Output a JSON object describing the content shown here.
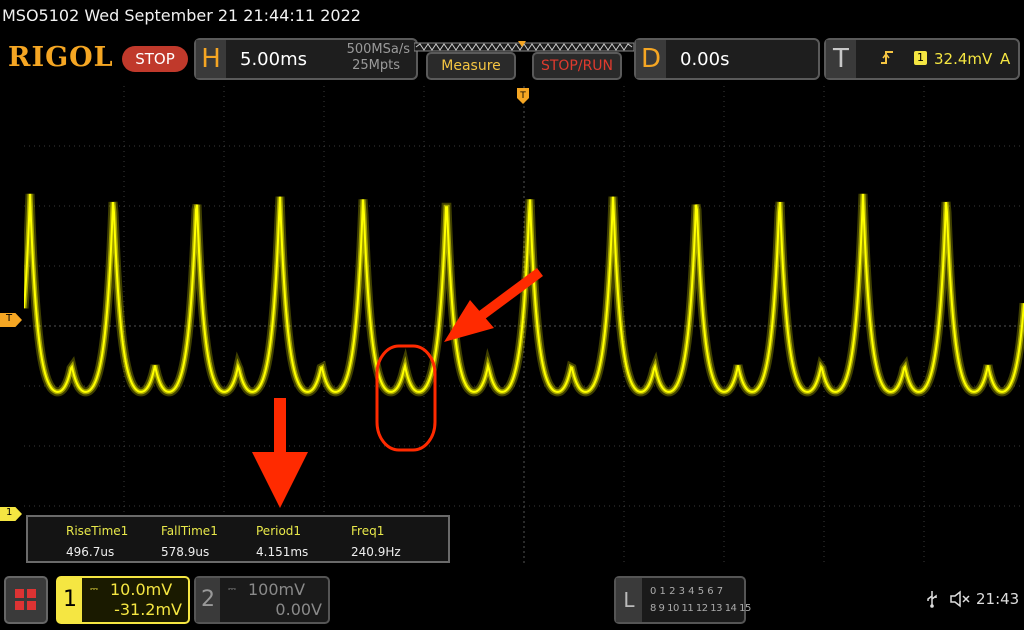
{
  "header": {
    "status_line": "MSO5102  Wed September 21 21:44:11 2022",
    "logo": "RIGOL",
    "run_state": "STOP"
  },
  "horizontal": {
    "key": "H",
    "timebase": "5.00ms",
    "sample_rate": "500MSa/s",
    "memory_depth": "25Mpts"
  },
  "buttons": {
    "measure": "Measure",
    "stop_run": "STOP/RUN"
  },
  "delay": {
    "key": "D",
    "value": "0.00s"
  },
  "trigger": {
    "key": "T",
    "channel": "1",
    "level": "32.4mV",
    "mode": "A"
  },
  "markers": {
    "trigger_left": "T",
    "channel1_ground": "1"
  },
  "measurements": [
    {
      "label": "RiseTime1",
      "value": "496.7us"
    },
    {
      "label": "FallTime1",
      "value": "578.9us"
    },
    {
      "label": "Period1",
      "value": "4.151ms"
    },
    {
      "label": "Freq1",
      "value": "240.9Hz"
    }
  ],
  "channel1": {
    "number": "1",
    "scale": "10.0mV",
    "offset": "-31.2mV"
  },
  "channel2": {
    "number": "2",
    "scale": "100mV",
    "offset": "0.00V"
  },
  "logic": {
    "key": "L",
    "row1": "0 1 2 3  4 5 6 7",
    "row2": "8 9 10 11 12 13 14 15"
  },
  "status": {
    "time": "21:43"
  },
  "colors": {
    "trace": "#ffff00",
    "accent": "#f5a623",
    "annotation": "#ff2a00"
  }
}
